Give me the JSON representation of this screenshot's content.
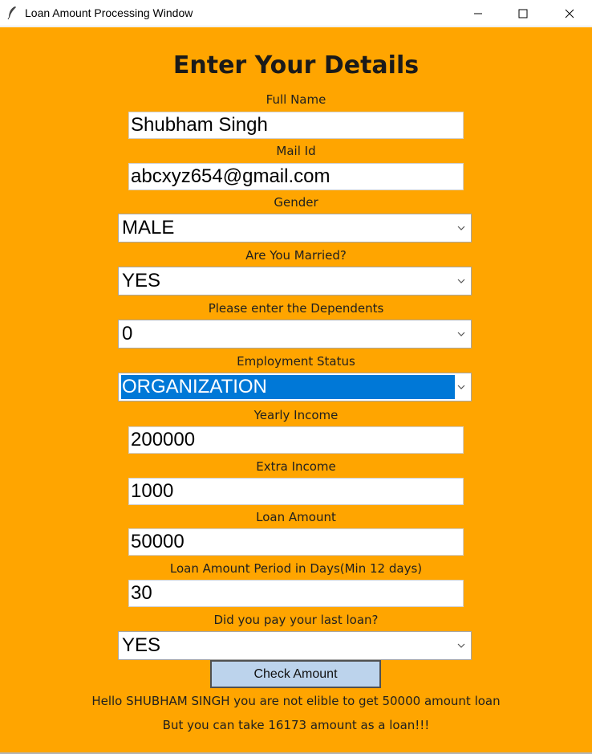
{
  "window": {
    "title": "Loan Amount Processing Window",
    "icon": "feather-icon",
    "controls": [
      "minimize-icon",
      "maximize-icon",
      "close-icon"
    ],
    "background_color": "#ffa500"
  },
  "form": {
    "heading": "Enter Your Details",
    "full_name": {
      "label": "Full Name",
      "value": "Shubham Singh"
    },
    "mail_id": {
      "label": "Mail Id",
      "value": "abcxyz654@gmail.com"
    },
    "gender": {
      "label": "Gender",
      "value": "MALE"
    },
    "married": {
      "label": "Are You Married?",
      "value": "YES"
    },
    "dependents": {
      "label": "Please enter the Dependents",
      "value": "0"
    },
    "employment": {
      "label": "Employment Status",
      "value": "ORGANIZATION"
    },
    "yearly_income": {
      "label": "Yearly Income",
      "value": "200000"
    },
    "extra_income": {
      "label": "Extra Income",
      "value": "1000"
    },
    "loan_amount": {
      "label": "Loan Amount",
      "value": "50000"
    },
    "loan_period": {
      "label": "Loan Amount Period in Days(Min 12 days)",
      "value": "30"
    },
    "last_loan_paid": {
      "label": "Did you pay your last loan?",
      "value": "YES"
    },
    "check_button": "Check Amount"
  },
  "result": {
    "line1": "Hello SHUBHAM SINGH you are not elible to get 50000 amount loan",
    "line2": "But you can take 16173 amount as a loan!!!"
  },
  "colors": {
    "button_bg": "#bcd3ec",
    "selection": "#0078d7"
  }
}
